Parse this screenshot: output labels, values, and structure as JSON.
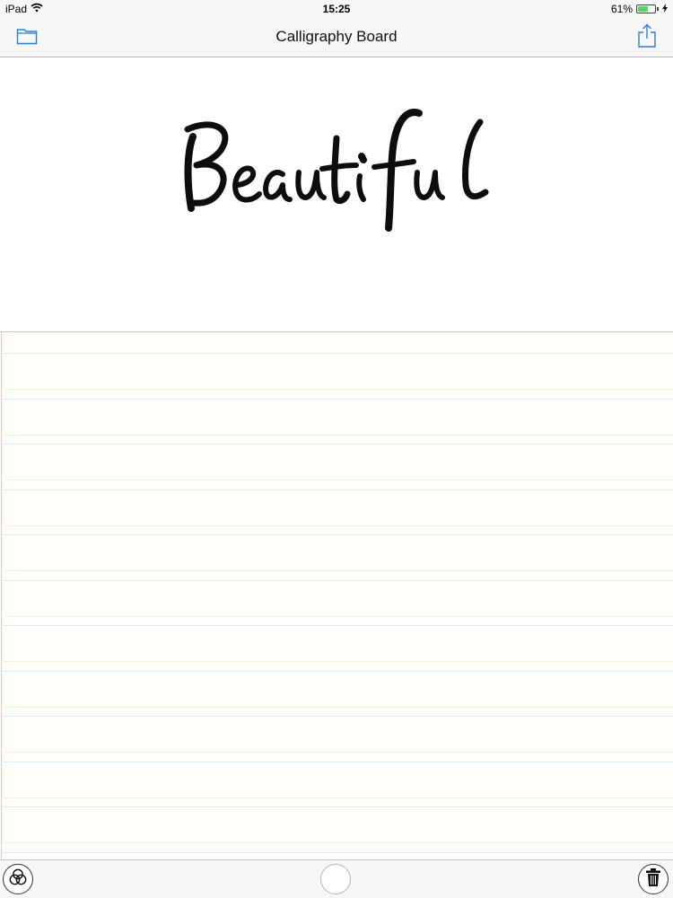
{
  "status_bar": {
    "device": "iPad",
    "time": "15:25",
    "battery": "61%",
    "battery_level": 0.61,
    "icons": [
      "wifi-icon",
      "battery-icon",
      "charging-bolt-icon"
    ]
  },
  "nav_bar": {
    "title": "Calligraphy Board",
    "left_icon": "folder-icon",
    "right_icon": "share-icon"
  },
  "canvas": {
    "handwritten_text": "Beautiful",
    "ink_color": "#0d0d0d",
    "paper": "ruled"
  },
  "toolbar": {
    "items": [
      "color-palette-icon",
      "brush-size-button",
      "trash-icon"
    ]
  },
  "colors": {
    "accent": "#2b7ddb",
    "chrome": "#f7f7f8",
    "battery_fill": "#4cd964",
    "margin_line": "#f3c0c0",
    "rule_blue": "#dceef7",
    "rule_yellow": "#fbf3d8"
  }
}
